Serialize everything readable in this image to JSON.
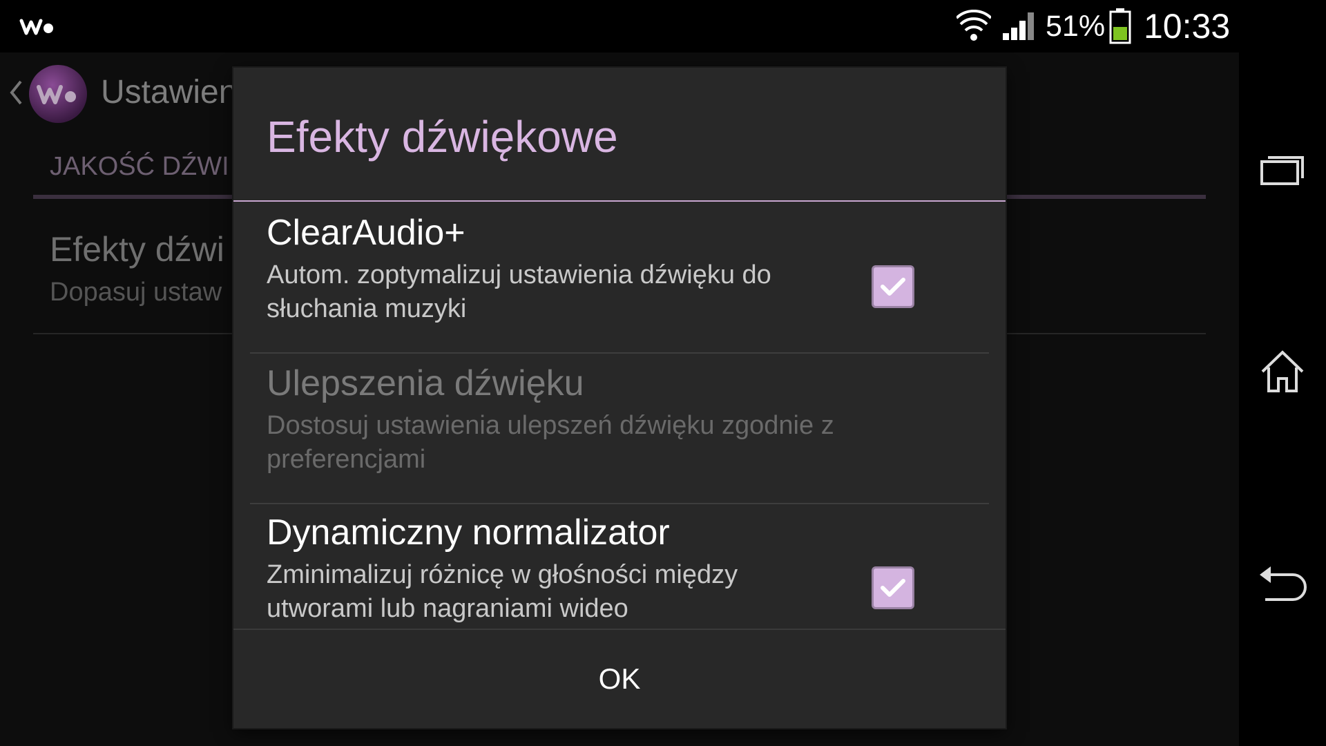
{
  "status_bar": {
    "battery_percent": "51%",
    "battery_level": 0.51,
    "clock": "10:33",
    "icons": [
      "walkman-icon",
      "wifi-icon",
      "signal-icon",
      "battery-icon"
    ]
  },
  "app": {
    "title": "Ustawien",
    "section_header": "JAKOŚĆ DŹWI",
    "item_title": "Efekty dźwi",
    "item_summary": "Dopasuj ustaw"
  },
  "dialog": {
    "title": "Efekty dźwiękowe",
    "options": [
      {
        "title": "ClearAudio+",
        "summary": "Autom. zoptymalizuj ustawienia dźwięku do słuchania muzyki",
        "checked": true,
        "enabled": true
      },
      {
        "title": "Ulepszenia dźwięku",
        "summary": "Dostosuj ustawienia ulepszeń dźwięku zgodnie z preferencjami",
        "enabled": false
      },
      {
        "title": "Dynamiczny normalizator",
        "summary": "Zminimalizuj różnicę w głośności między utworami lub nagraniami wideo",
        "checked": true,
        "enabled": true
      }
    ],
    "ok_label": "OK"
  },
  "colors": {
    "accent": "#d9b6e2",
    "checkbox_fill": "#d4b4e0",
    "dialog_bg": "#282828",
    "battery_green": "#7ec420"
  },
  "nav_bar": {
    "icons": [
      "recents-icon",
      "home-icon",
      "back-icon"
    ]
  }
}
